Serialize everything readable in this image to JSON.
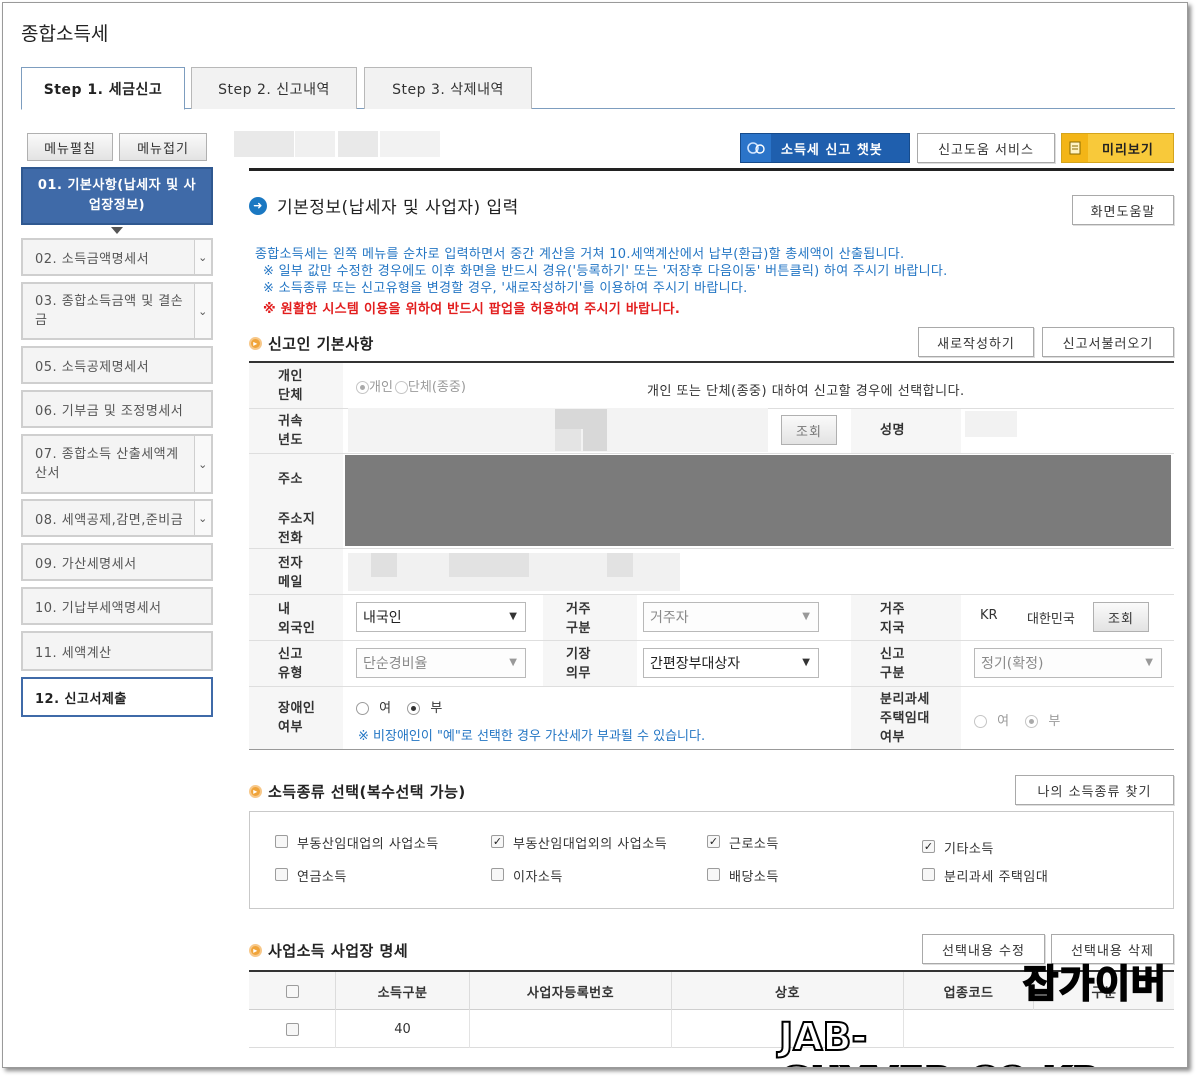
{
  "app": {
    "title": "종합소득세"
  },
  "tabs": [
    {
      "label": "Step 1. 세금신고"
    },
    {
      "label": "Step 2. 신고내역"
    },
    {
      "label": "Step 3. 삭제내역"
    }
  ],
  "sidebar": {
    "expand_label": "메뉴펼침",
    "collapse_label": "메뉴접기",
    "items": [
      {
        "label": "01. 기본사항(납세자 및 사업장정보)"
      },
      {
        "label": "02. 소득금액명세서"
      },
      {
        "label": "03. 종합소득금액 및 결손금"
      },
      {
        "label": "05. 소득공제명세서"
      },
      {
        "label": "06. 기부금 및 조정명세서"
      },
      {
        "label": "07. 종합소득 산출세액계산서"
      },
      {
        "label": "08. 세액공제,감면,준비금"
      },
      {
        "label": "09. 가산세명세서"
      },
      {
        "label": "10. 기납부세액명세서"
      },
      {
        "label": "11. 세액계산"
      },
      {
        "label": "12. 신고서제출"
      }
    ]
  },
  "toolbar": {
    "chatbot_label": "소득세 신고 챗봇",
    "help_service_label": "신고도움 서비스",
    "preview_label": "미리보기"
  },
  "main": {
    "page_title": "기본정보(납세자 및 사업자) 입력",
    "screen_help_label": "화면도움말",
    "info_lines": [
      "종합소득세는 왼쪽 메뉴를 순차로 입력하면서 중간 계산을 거쳐 10.세액계산에서 납부(환급)할 총세액이 산출됩니다.",
      "※ 일부 값만 수정한 경우에도 이후 화면을 반드시 경유('등록하기' 또는 '저장후 다음이동' 버튼클릭) 하여 주시기 바랍니다.",
      "※ 소득종류 또는 신고유형을 변경할 경우, '새로작성하기'를 이용하여 주시기 바랍니다."
    ],
    "warning_line": "※ 원활한 시스템 이용을 위하여 반드시 팝업을 허용하여 주시기 바랍니다."
  },
  "basic": {
    "section_title": "신고인 기본사항",
    "new_button": "새로작성하기",
    "load_button": "신고서불러오기",
    "labels": {
      "type1": "개인",
      "type2": "단체",
      "year1": "귀속",
      "year2": "년도",
      "address": "주소",
      "phone1": "주소지",
      "phone2": "전화",
      "email1": "전자",
      "email2": "메일",
      "foreign1": "내",
      "foreign2": "외국인",
      "residence1": "거주",
      "residence2": "구분",
      "region1": "거주",
      "region2": "지국",
      "filing_type1": "신고",
      "filing_type2": "유형",
      "bookkeeping1": "기장",
      "bookkeeping2": "의무",
      "filing_class1": "신고",
      "filing_class2": "구분",
      "disabled1": "장애인",
      "disabled2": "여부",
      "separate1": "분리과세",
      "separate2": "주택임대",
      "separate3": "여부",
      "name": "성명"
    },
    "type_options": {
      "individual": "개인",
      "group": "단체(종중)"
    },
    "type_help": "개인 또는 단체(종중) 대하여 신고할 경우에 선택합니다.",
    "lookup_button": "조회",
    "foreign_value": "내국인",
    "residence_value": "거주자",
    "region_code": "KR",
    "region_name": "대한민국",
    "region_lookup": "조회",
    "filing_type_value": "단순경비율",
    "bookkeeping_value": "간편장부대상자",
    "filing_class_value": "정기(확정)",
    "yes_label": "여",
    "no_label": "부",
    "disabled_note": "※ 비장애인이 \"예\"로 선택한 경우 가산세가 부과될 수 있습니다."
  },
  "income": {
    "section_title": "소득종류 선택(복수선택 가능)",
    "find_button": "나의 소득종류 찾기",
    "options": [
      {
        "label": "부동산임대업의 사업소득",
        "checked": false
      },
      {
        "label": "부동산임대업외의 사업소득",
        "checked": true
      },
      {
        "label": "근로소득",
        "checked": true
      },
      {
        "label": "기타소득",
        "checked": true
      },
      {
        "label": "연금소득",
        "checked": false
      },
      {
        "label": "이자소득",
        "checked": false
      },
      {
        "label": "배당소득",
        "checked": false
      },
      {
        "label": "분리과세 주택임대",
        "checked": false
      }
    ]
  },
  "business": {
    "section_title": "사업소득 사업장 명세",
    "edit_button": "선택내용 수정",
    "delete_button": "선택내용 삭제",
    "columns": [
      "소득구분",
      "사업자등록번호",
      "상호",
      "업종코드",
      "구분"
    ],
    "rows": [
      {
        "income_type": "40"
      }
    ]
  },
  "watermark": {
    "name": "잡가이버",
    "site": "JAB-GUYVER.CO.KR"
  }
}
